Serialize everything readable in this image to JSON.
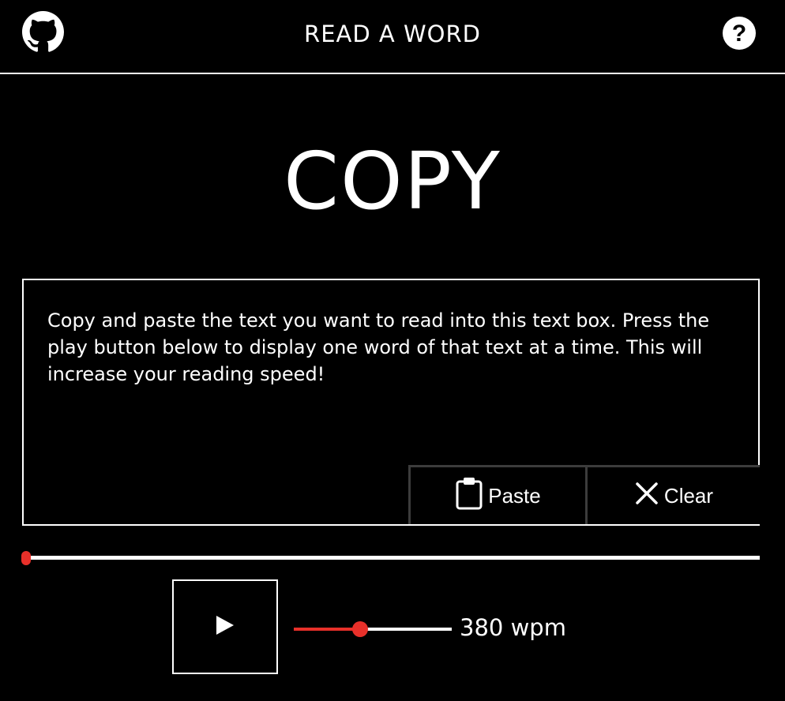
{
  "header": {
    "title": "READ A WORD",
    "github_icon": "github-icon",
    "help_icon": "help-circle-icon"
  },
  "reader": {
    "current_word": "COPY"
  },
  "text_box": {
    "text": "Copy and paste the text you want to read into this text box. Press the play button below to display one word of that text at a time. This will increase your reading speed!",
    "paste_label": "Paste",
    "clear_label": "Clear",
    "paste_icon": "clipboard-icon",
    "clear_icon": "close-icon"
  },
  "progress": {
    "fraction": 0.0
  },
  "controls": {
    "play_icon": "play-icon",
    "speed_fraction": 0.42,
    "speed_label": "380 wpm"
  },
  "colors": {
    "background": "#000000",
    "foreground": "#ffffff",
    "accent": "#e8302a",
    "button_border": "#3c3c3c"
  }
}
